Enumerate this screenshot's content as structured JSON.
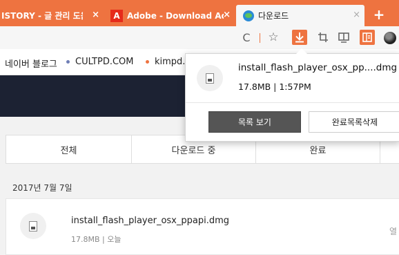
{
  "tabs": [
    {
      "title": "ISTORY - 글 관리 도움말",
      "close": "×"
    },
    {
      "title": "Adobe - Download Adobe",
      "close": "×",
      "icon": "adobe-icon"
    },
    {
      "title": "다운로드",
      "close": "×",
      "icon": "globe-icon",
      "active": true
    }
  ],
  "new_tab": "+",
  "toolbar": {
    "reload": "C",
    "bookmark_star": "☆"
  },
  "bookmarks": [
    {
      "label": "네이버 블로그",
      "dot_color": "#ee7340"
    },
    {
      "label": "CULTPD.COM",
      "dot_color": "#6f7fb6"
    },
    {
      "label": "kimpd.c",
      "dot_color": "#ee7340"
    }
  ],
  "popup": {
    "file_name": "install_flash_player_osx_pp....dmg",
    "meta": "17.8MB | 1:57PM",
    "show_list_label": "목록 보기",
    "clear_list_label": "완료목록삭제"
  },
  "downloads_page": {
    "filters": [
      "전체",
      "다운로드 중",
      "완료"
    ],
    "date_header": "2017년 7월 7일",
    "item": {
      "name": "install_flash_player_osx_ppapi.dmg",
      "meta": "17.8MB | 오늘",
      "action": "열"
    }
  },
  "colors": {
    "accent": "#ee7340",
    "page_header": "#1c2233",
    "page_background": "#f2f2f2"
  }
}
